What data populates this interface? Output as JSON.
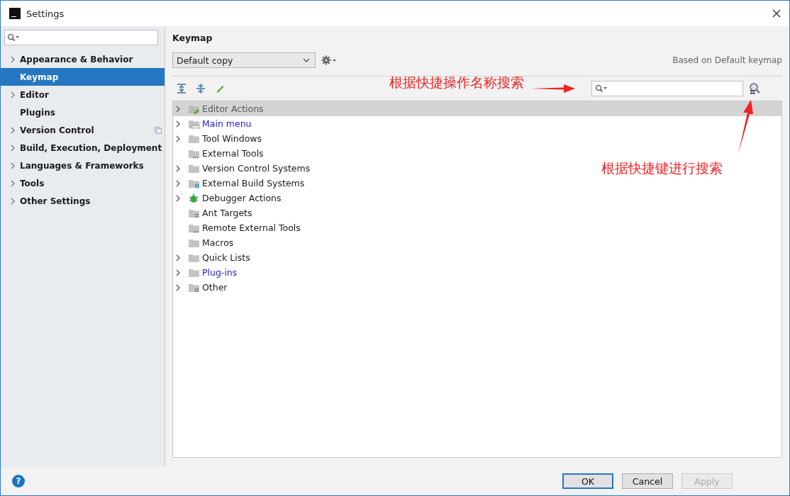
{
  "window": {
    "title": "Settings"
  },
  "sidebar": {
    "items": [
      {
        "label": "Appearance & Behavior",
        "expandable": true,
        "selected": false,
        "project_level": false
      },
      {
        "label": "Keymap",
        "expandable": false,
        "selected": true,
        "project_level": false
      },
      {
        "label": "Editor",
        "expandable": true,
        "selected": false,
        "project_level": false
      },
      {
        "label": "Plugins",
        "expandable": false,
        "selected": false,
        "project_level": false
      },
      {
        "label": "Version Control",
        "expandable": true,
        "selected": false,
        "project_level": true
      },
      {
        "label": "Build, Execution, Deployment",
        "expandable": true,
        "selected": false,
        "project_level": false
      },
      {
        "label": "Languages & Frameworks",
        "expandable": true,
        "selected": false,
        "project_level": false
      },
      {
        "label": "Tools",
        "expandable": true,
        "selected": false,
        "project_level": false
      },
      {
        "label": "Other Settings",
        "expandable": true,
        "selected": false,
        "project_level": false
      }
    ]
  },
  "content": {
    "title": "Keymap",
    "keymap_select": "Default copy",
    "based_on": "Based on Default keymap",
    "tree": [
      {
        "label": "Editor Actions",
        "expandable": true,
        "selected": true,
        "modified": false,
        "kind": "folder_pencil"
      },
      {
        "label": "Main menu",
        "expandable": true,
        "selected": false,
        "modified": true,
        "kind": "folder_menu"
      },
      {
        "label": "Tool Windows",
        "expandable": true,
        "selected": false,
        "modified": false,
        "kind": "folder"
      },
      {
        "label": "External Tools",
        "expandable": false,
        "selected": false,
        "modified": false,
        "kind": "folder_dots"
      },
      {
        "label": "Version Control Systems",
        "expandable": true,
        "selected": false,
        "modified": false,
        "kind": "folder"
      },
      {
        "label": "External Build Systems",
        "expandable": true,
        "selected": false,
        "modified": false,
        "kind": "folder_gear"
      },
      {
        "label": "Debugger Actions",
        "expandable": true,
        "selected": false,
        "modified": false,
        "kind": "bug"
      },
      {
        "label": "Ant Targets",
        "expandable": false,
        "selected": false,
        "modified": false,
        "kind": "folder_grid"
      },
      {
        "label": "Remote External Tools",
        "expandable": false,
        "selected": false,
        "modified": false,
        "kind": "folder_dots"
      },
      {
        "label": "Macros",
        "expandable": false,
        "selected": false,
        "modified": false,
        "kind": "folder"
      },
      {
        "label": "Quick Lists",
        "expandable": true,
        "selected": false,
        "modified": false,
        "kind": "folder"
      },
      {
        "label": "Plug-ins",
        "expandable": true,
        "selected": false,
        "modified": true,
        "kind": "folder"
      },
      {
        "label": "Other",
        "expandable": true,
        "selected": false,
        "modified": false,
        "kind": "folder_grid"
      }
    ]
  },
  "annotations": [
    {
      "text": "根据快捷操作名称搜索"
    },
    {
      "text": "根据快捷键进行搜索"
    }
  ],
  "help_button": "?",
  "buttons": [
    {
      "label": "OK",
      "default": true,
      "disabled": false
    },
    {
      "label": "Cancel",
      "default": false,
      "disabled": false
    },
    {
      "label": "Apply",
      "default": false,
      "disabled": true
    }
  ]
}
